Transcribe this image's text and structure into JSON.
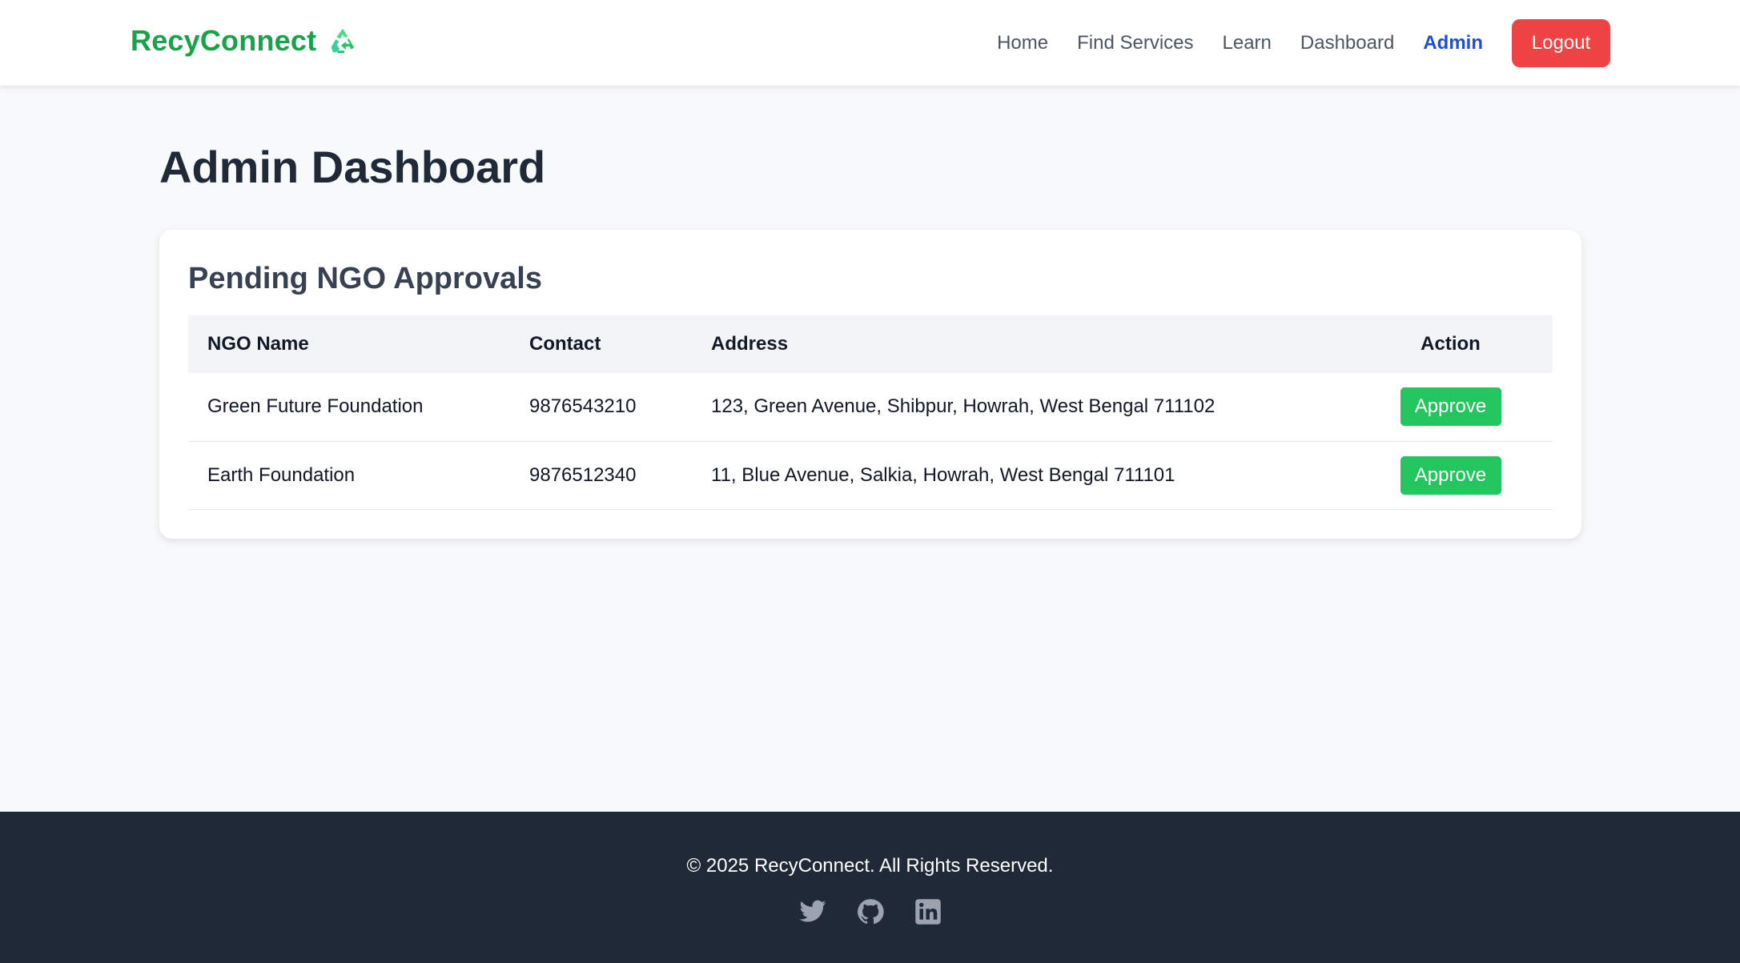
{
  "header": {
    "brand": "RecyConnect",
    "brand_icon": "recycle-icon",
    "nav_links": [
      {
        "label": "Home",
        "active": false
      },
      {
        "label": "Find Services",
        "active": false
      },
      {
        "label": "Learn",
        "active": false
      },
      {
        "label": "Dashboard",
        "active": false
      },
      {
        "label": "Admin",
        "active": true
      }
    ],
    "logout_label": "Logout"
  },
  "main": {
    "title": "Admin Dashboard",
    "approvals": {
      "title": "Pending NGO Approvals",
      "columns": [
        "NGO Name",
        "Contact",
        "Address",
        "Action"
      ],
      "rows": [
        {
          "name": "Green Future Foundation",
          "contact": "9876543210",
          "address": "123, Green Avenue, Shibpur, Howrah, West Bengal 711102",
          "action": "Approve"
        },
        {
          "name": "Earth Foundation",
          "contact": "9876512340",
          "address": "11, Blue Avenue, Salkia, Howrah, West Bengal 711101",
          "action": "Approve"
        }
      ]
    }
  },
  "footer": {
    "copyright": "© 2025 RecyConnect. All Rights Reserved.",
    "social_icons": [
      "twitter-icon",
      "github-icon",
      "linkedin-icon"
    ]
  },
  "colors": {
    "brand": "#16a34a",
    "active_link": "#1d4ed8",
    "logout": "#ef4444",
    "approve": "#22c55e",
    "footer_bg": "#1f2937",
    "page_bg": "#f8f9fb"
  }
}
